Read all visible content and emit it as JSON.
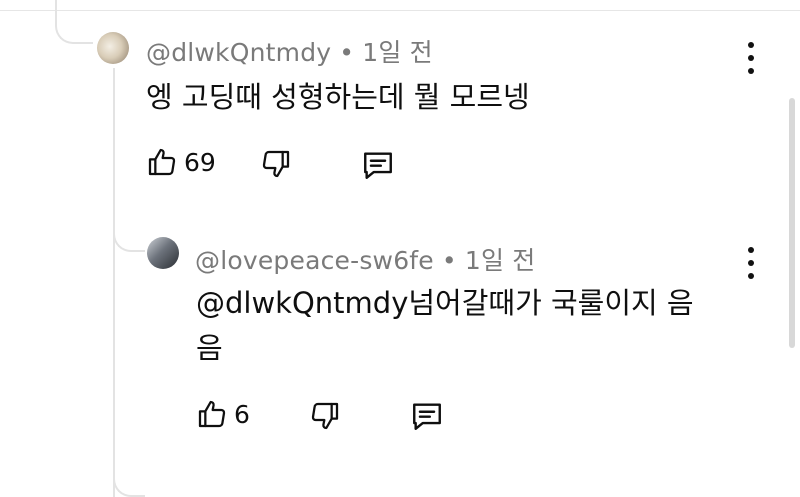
{
  "comment": {
    "author": "@dlwkQntmdy",
    "separator": "•",
    "time": "1일 전",
    "text": "엥 고딩때 성형하는데 뭘 모르넹",
    "like_count": "69"
  },
  "reply": {
    "author": "@lovepeace-sw6fe",
    "separator": "•",
    "time": "1일 전",
    "text_line1": "@dlwkQntmdy넘어갈때가 국룰이지 음",
    "text_line2": "음",
    "like_count": "6"
  },
  "next_reply_partial": {
    "text": ""
  },
  "icons": {
    "like": "thumbs-up-icon",
    "dislike": "thumbs-down-icon",
    "reply": "comment-icon",
    "menu": "more-vertical-icon"
  }
}
